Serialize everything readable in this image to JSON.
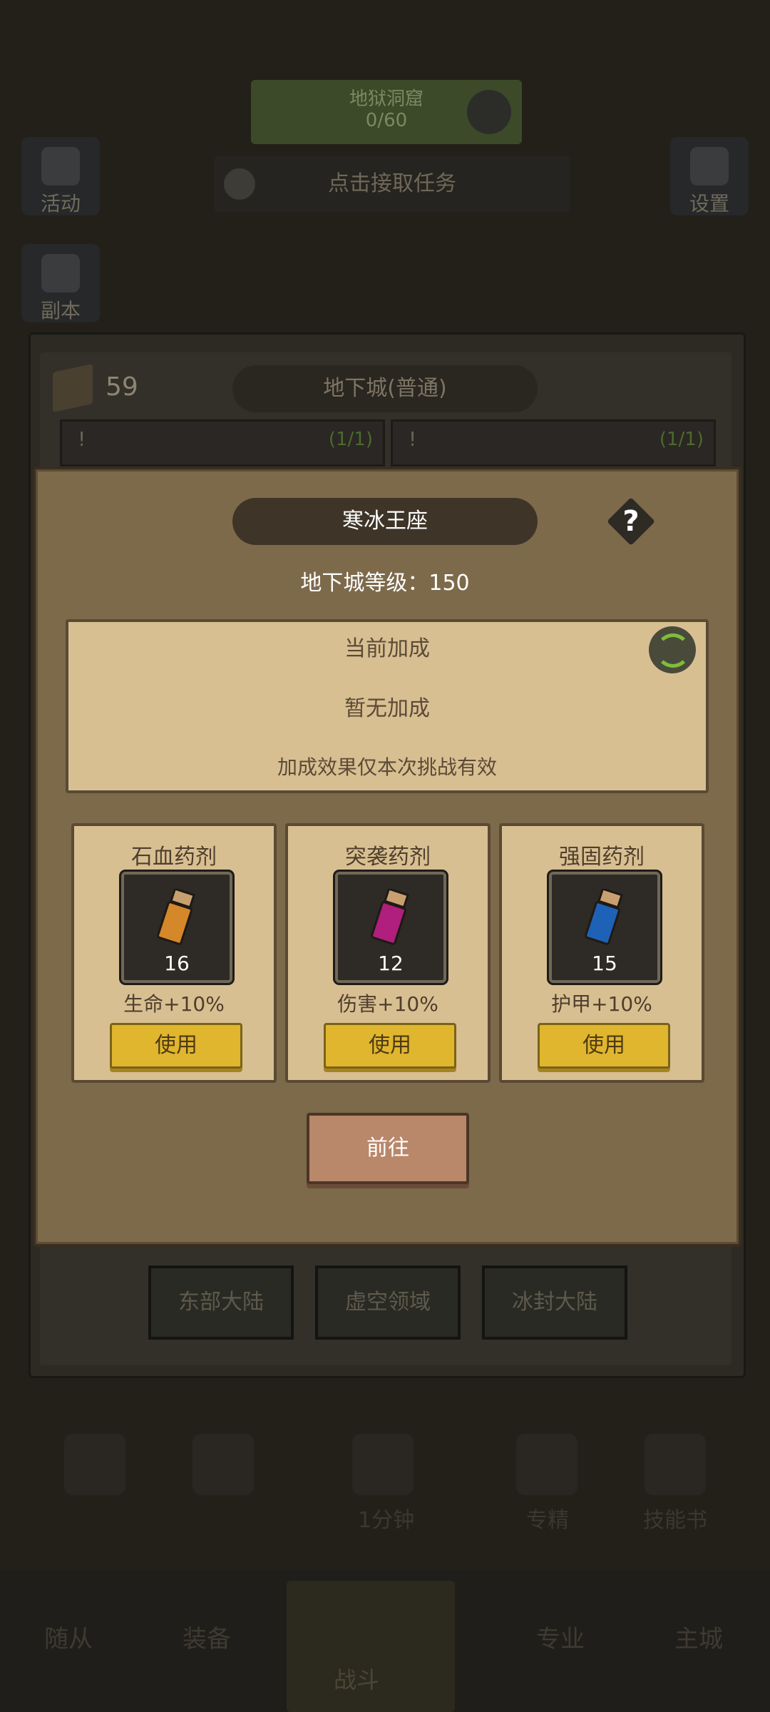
{
  "background": {
    "top_banner": {
      "line1": "地狱洞窟",
      "line2": "0/60"
    },
    "task_bar": {
      "label": "点击接取任务"
    },
    "side_buttons": {
      "activity": "活动",
      "settings": "设置",
      "instance": "副本"
    },
    "dungeon": {
      "resource_count": "59",
      "title": "地下城(普通)",
      "card_left_count": "(1/1)",
      "card_right_count": "(1/1)",
      "card_mark": "!"
    },
    "regions": [
      "东部大陆",
      "虚空领域",
      "冰封大陆"
    ],
    "mid_row": {
      "timer": "1分钟",
      "expertise": "专精",
      "skill_book": "技能书"
    },
    "bottom_nav": {
      "followers": "随从",
      "equipment": "装备",
      "battle": "战斗",
      "profession": "专业",
      "main_city": "主城"
    }
  },
  "modal": {
    "title": "寒冰王座",
    "help_label": "?",
    "level_label": "地下城等级：150",
    "bonus": {
      "title": "当前加成",
      "value": "暂无加成",
      "note": "加成效果仅本次挑战有效"
    },
    "potions": [
      {
        "name": "石血药剂",
        "qty": "16",
        "effect": "生命+10%",
        "button": "使用",
        "color": "#d4882a"
      },
      {
        "name": "突袭药剂",
        "qty": "12",
        "effect": "伤害+10%",
        "button": "使用",
        "color": "#b01e7e"
      },
      {
        "name": "强固药剂",
        "qty": "15",
        "effect": "护甲+10%",
        "button": "使用",
        "color": "#1e62b8"
      }
    ],
    "go_button": "前往"
  }
}
